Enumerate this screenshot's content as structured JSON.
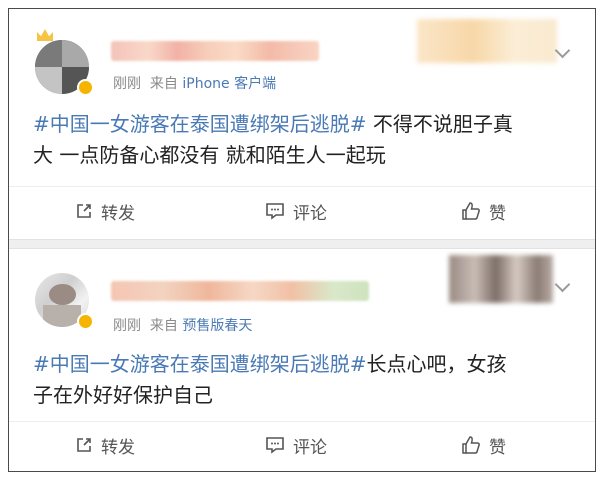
{
  "posts": [
    {
      "time": "刚刚",
      "source_prefix": "来自",
      "source": "iPhone 客户端",
      "hashtag": "#中国一女游客在泰国遭绑架后逃脱#",
      "line1_rest": " 不得不说胆子真",
      "line2": "大 一点防备心都没有 就和陌生人一起玩",
      "actions": {
        "repost": "转发",
        "comment": "评论",
        "like": "赞"
      }
    },
    {
      "time": "刚刚",
      "source_prefix": "来自",
      "source": "预售版春天",
      "hashtag": "#中国一女游客在泰国遭绑架后逃脱#",
      "line1_rest": "长点心吧，女孩",
      "line2": "子在外好好保护自己",
      "actions": {
        "repost": "转发",
        "comment": "评论",
        "like": "赞"
      }
    }
  ],
  "colors": {
    "link": "#4a7ab6",
    "meta": "#8a8a8a",
    "text": "#222222",
    "divider": "#efefef"
  },
  "icons": [
    "repost-icon",
    "comment-icon",
    "like-icon",
    "chevron-down-icon",
    "verified-badge-icon",
    "crown-icon"
  ]
}
